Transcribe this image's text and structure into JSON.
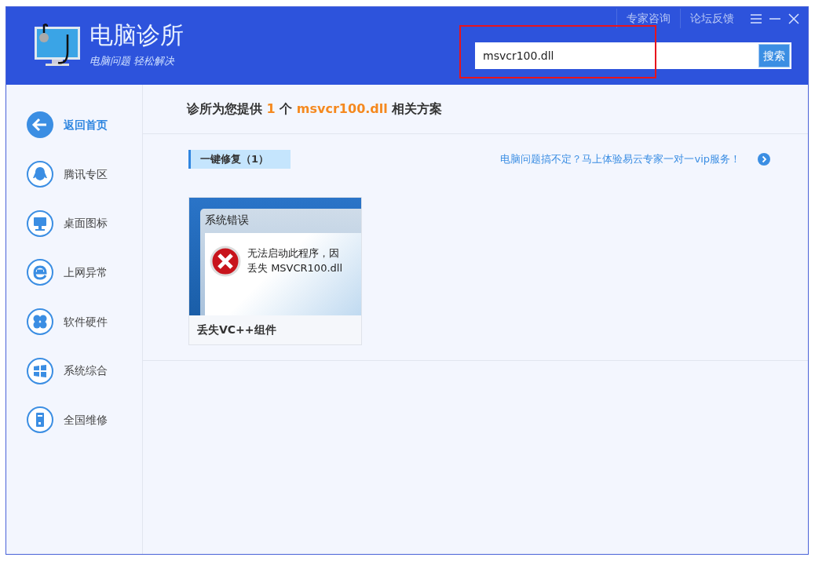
{
  "app": {
    "title": "电脑诊所",
    "slogan": "电脑问题 轻松解决"
  },
  "top_links": [
    "专家咨询",
    "论坛反馈"
  ],
  "search": {
    "value": "msvcr100.dll",
    "button": "搜索",
    "highlighted": true
  },
  "sidebar": {
    "items": [
      {
        "label": "返回首页",
        "selected": true
      },
      {
        "label": "腾讯专区",
        "selected": false
      },
      {
        "label": "桌面图标",
        "selected": false
      },
      {
        "label": "上网异常",
        "selected": false
      },
      {
        "label": "软件硬件",
        "selected": false
      },
      {
        "label": "系统综合",
        "selected": false
      },
      {
        "label": "全国维修",
        "selected": false
      }
    ]
  },
  "result_heading": [
    {
      "text": "诊所为您提供 ",
      "highlight": false
    },
    {
      "text": "1",
      "highlight": true
    },
    {
      "text": " 个 ",
      "highlight": false
    },
    {
      "text": "msvcr100.dll",
      "highlight": true
    },
    {
      "text": " 相关方案",
      "highlight": false
    }
  ],
  "section_tab": {
    "label": "一键修复（1）",
    "selected": true
  },
  "promo_link": "电脑问题搞不定？马上体验易云专家一对一vip服务！",
  "solutions": [
    {
      "caption": "丢失VC++组件",
      "thumbnail": {
        "dialog_title": "系统错误",
        "message_lines": [
          "无法启动此程序，因",
          "丢失 MSVCR100.dll"
        ]
      }
    }
  ]
}
